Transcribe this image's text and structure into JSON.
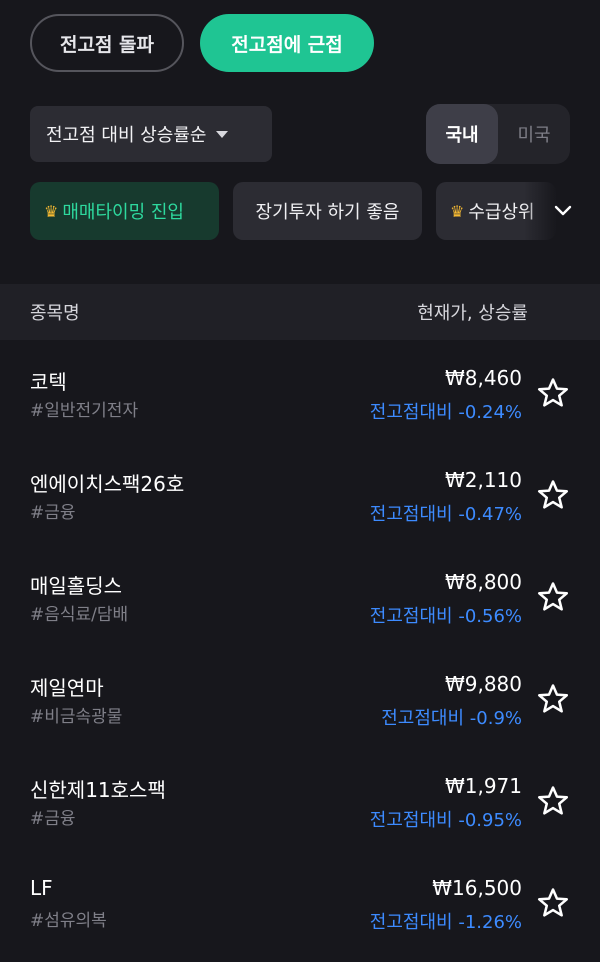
{
  "top_tabs": {
    "breakout_label": "전고점 돌파",
    "near_label": "전고점에 근접"
  },
  "sort": {
    "label": "전고점 대비 상승률순"
  },
  "market": {
    "domestic": "국내",
    "us": "미국"
  },
  "chips": [
    {
      "label": "매매타이밍 진입"
    },
    {
      "label": "장기투자 하기 좋음"
    },
    {
      "label": "수급상위"
    }
  ],
  "columns": {
    "name": "종목명",
    "price_change": "현재가, 상승률"
  },
  "stocks": [
    {
      "name": "코텍",
      "tag": "#일반전기전자",
      "price": "₩8,460",
      "change": "전고점대비 -0.24%"
    },
    {
      "name": "엔에이치스팩26호",
      "tag": "#금융",
      "price": "₩2,110",
      "change": "전고점대비 -0.47%"
    },
    {
      "name": "매일홀딩스",
      "tag": "#음식료/담배",
      "price": "₩8,800",
      "change": "전고점대비 -0.56%"
    },
    {
      "name": "제일연마",
      "tag": "#비금속광물",
      "price": "₩9,880",
      "change": "전고점대비 -0.9%"
    },
    {
      "name": "신한제11호스팩",
      "tag": "#금융",
      "price": "₩1,971",
      "change": "전고점대비 -0.95%"
    },
    {
      "name": "LF",
      "tag": "#섬유의복",
      "price": "₩16,500",
      "change": "전고점대비 -1.26%"
    }
  ],
  "colors": {
    "accent": "#1fc593",
    "negative": "#3d8bff",
    "background": "#17171c"
  }
}
